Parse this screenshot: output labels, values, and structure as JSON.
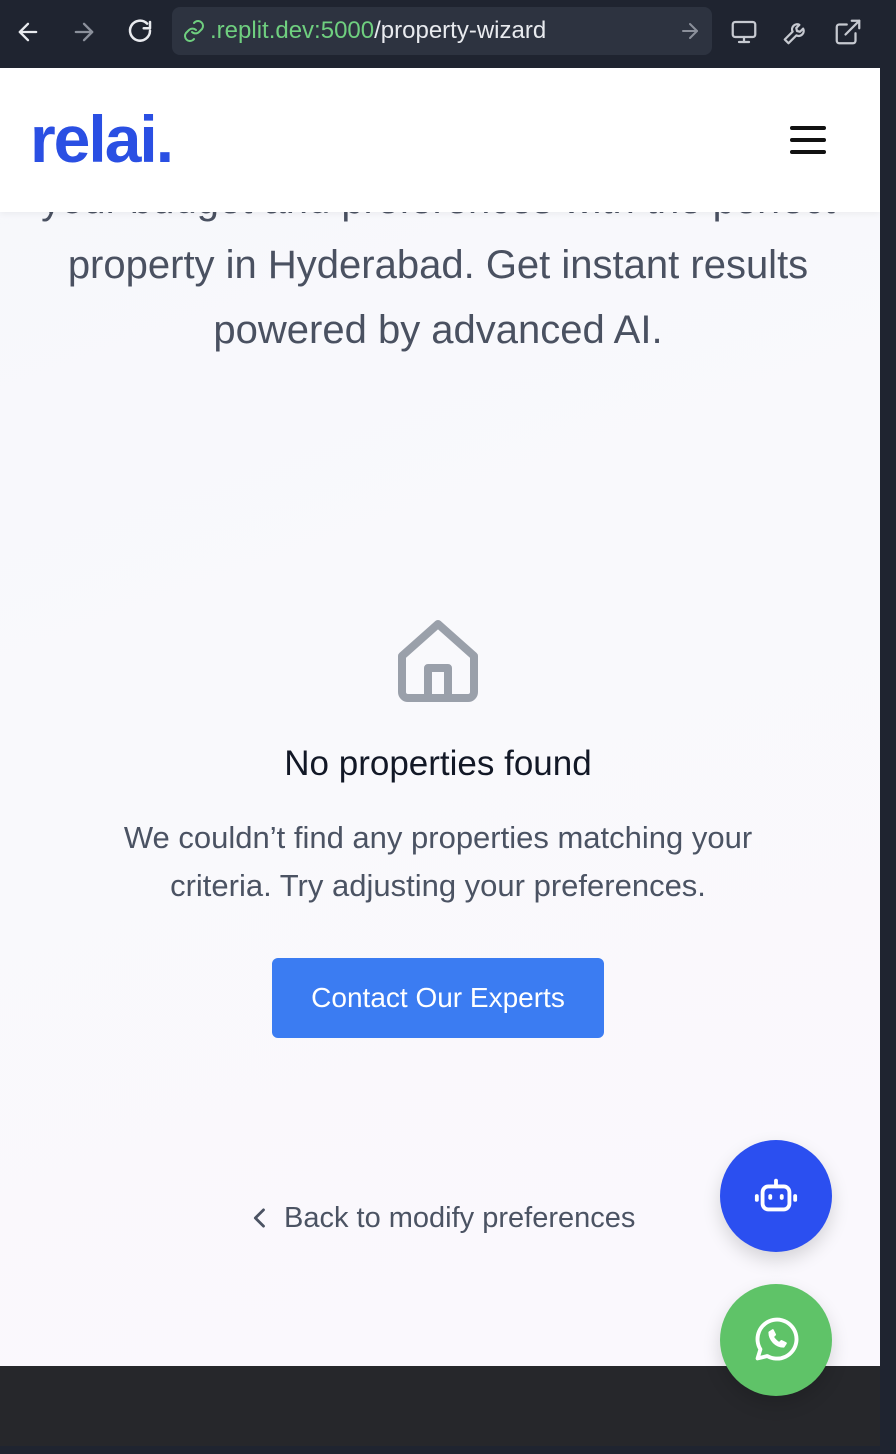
{
  "browser": {
    "url_host": ".replit.dev:5000",
    "url_path": "/property-wizard"
  },
  "header": {
    "logo_text": "relai."
  },
  "hero": {
    "subtitle": "your budget and preferences with the perfect property in Hyderabad. Get instant results powered by advanced AI."
  },
  "empty_state": {
    "title": "No properties found",
    "description": "We couldn’t find any properties matching your criteria. Try adjusting your preferences.",
    "cta_label": "Contact Our Experts"
  },
  "back_link": {
    "label": "Back to modify preferences"
  },
  "colors": {
    "brand": "#2a4fe3",
    "cta": "#3b7cf2",
    "bot_fab": "#2b4ff0",
    "whatsapp_fab": "#5fc368"
  },
  "icons": [
    "back-arrow-icon",
    "forward-arrow-icon",
    "reload-icon",
    "link-icon",
    "go-arrow-icon",
    "monitor-icon",
    "wrench-icon",
    "external-link-icon",
    "hamburger-menu-icon",
    "house-icon",
    "chevron-left-icon",
    "robot-icon",
    "whatsapp-icon"
  ]
}
